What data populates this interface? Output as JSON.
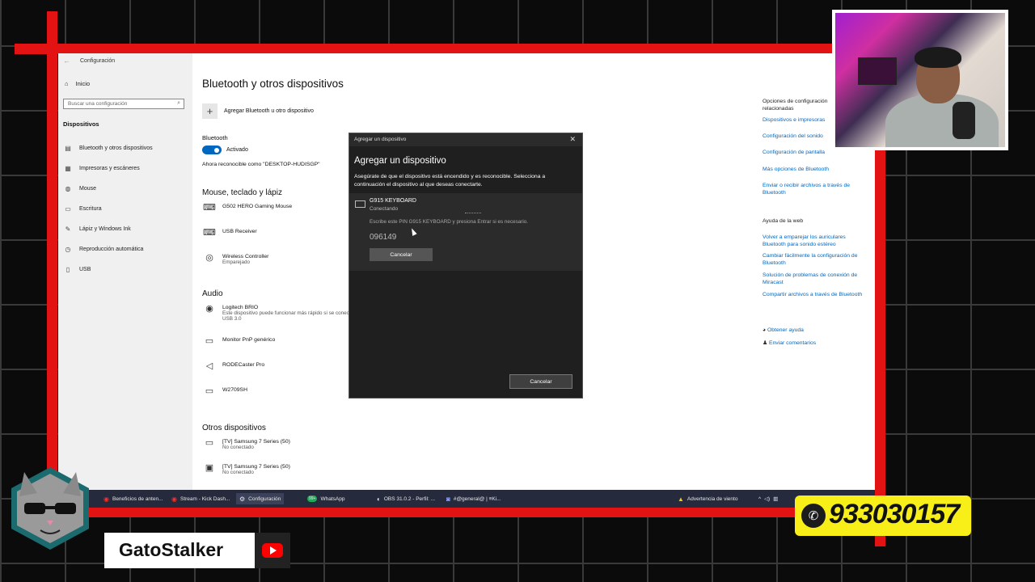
{
  "window": {
    "title": "Configuración",
    "back_glyph": "←"
  },
  "leftnav": {
    "home": "Inicio",
    "search_placeholder": "Buscar una configuración",
    "section": "Dispositivos",
    "items": [
      {
        "label": "Bluetooth y otros dispositivos",
        "icon": "bluetooth-icon"
      },
      {
        "label": "Impresoras y escáneres",
        "icon": "printer-icon"
      },
      {
        "label": "Mouse",
        "icon": "mouse-icon"
      },
      {
        "label": "Escritura",
        "icon": "keyboard-icon"
      },
      {
        "label": "Lápiz y Windows Ink",
        "icon": "pen-icon"
      },
      {
        "label": "Reproducción automática",
        "icon": "autoplay-icon"
      },
      {
        "label": "USB",
        "icon": "usb-icon"
      }
    ]
  },
  "main": {
    "title": "Bluetooth y otros dispositivos",
    "add_label": "Agregar Bluetooth u otro dispositivo",
    "bt_label": "Bluetooth",
    "bt_state": "Activado",
    "discoverable": "Ahora reconocible como \"DESKTOP-HUDISGP\"",
    "section_mouse": "Mouse, teclado y lápiz",
    "mouse_devices": [
      {
        "name": "G502 HERO Gaming Mouse",
        "status": ""
      },
      {
        "name": "USB Receiver",
        "status": ""
      },
      {
        "name": "Wireless Controller",
        "status": "Emparejado"
      }
    ],
    "section_audio": "Audio",
    "audio_devices": [
      {
        "name": "Logitech BRIO",
        "status": "Este dispositivo puede funcionar más rápido si se conecta a USB 3.0"
      },
      {
        "name": "Monitor PnP genérico",
        "status": ""
      },
      {
        "name": "RODECaster Pro",
        "status": ""
      },
      {
        "name": "W2709SH",
        "status": ""
      }
    ],
    "section_other": "Otros dispositivos",
    "other_devices": [
      {
        "name": "[TV] Samsung 7 Series (50)",
        "status": "No conectado"
      },
      {
        "name": "[TV] Samsung 7 Series (50)",
        "status": "No conectado"
      }
    ]
  },
  "right": {
    "related_head": "Opciones de configuración relacionadas",
    "related": [
      "Dispositivos e impresoras",
      "Configuración del sonido",
      "Configuración de pantalla",
      "Más opciones de Bluetooth",
      "Enviar o recibir archivos a través de Bluetooth"
    ],
    "help_head": "Ayuda de la web",
    "help": [
      "Volver a emparejar los auriculares Bluetooth para sonido estéreo",
      "Cambiar fácilmente la configuración de Bluetooth",
      "Solución de problemas de conexión de Miracast",
      "Compartir archivos a través de Bluetooth"
    ],
    "get_help": "Obtener ayuda",
    "feedback": "Enviar comentarios"
  },
  "dialog": {
    "bar_title": "Agregar un dispositivo",
    "title": "Agregar un dispositivo",
    "description": "Asegúrate de que el dispositivo está encendido y es reconocible. Selecciona a continuación el dispositivo al que deseas conectarte.",
    "device_name": "G915 KEYBOARD",
    "device_status": "Conectando",
    "pin_message": "Escribe este PIN G915 KEYBOARD y presiona Entrar si es necesario.",
    "pin": "096149",
    "cancel_inner": "Cancelar",
    "cancel_outer": "Cancelar"
  },
  "taskbar": {
    "items": [
      "Beneficios de anten...",
      "Stream - Kick Dash...",
      "Configuración",
      "WhatsApp",
      "OBS 31.0.2 - Perfil: ...",
      "#@general@ | ≡Ki..."
    ],
    "whatsapp_badge": "99+",
    "weather": "Advertencia de viento"
  },
  "overlay": {
    "channel": "GatoStalker",
    "phone": "933030157"
  },
  "colors": {
    "accent": "#0067c0",
    "frame_red": "#e31313",
    "whatsapp_yellow": "#f7ef17"
  }
}
